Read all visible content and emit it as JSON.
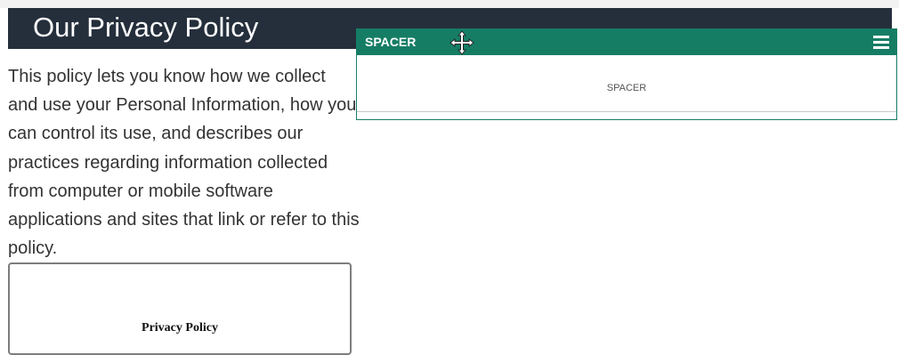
{
  "page": {
    "title": "Our Privacy Policy",
    "intro": "This policy lets you know how we collect and use your Personal Information, how you can control its use, and describes our practices regarding information collected from computer or mobile software applications and sites that link or refer to this policy.",
    "document_preview_title": "Privacy Policy"
  },
  "widget": {
    "header_label": "SPACER",
    "body_label": "SPACER",
    "move_icon": "move-arrows-icon",
    "menu_icon": "hamburger-menu-icon"
  },
  "colors": {
    "title_bar": "#252f3c",
    "widget_accent": "#167d65",
    "body_text": "#333333"
  }
}
